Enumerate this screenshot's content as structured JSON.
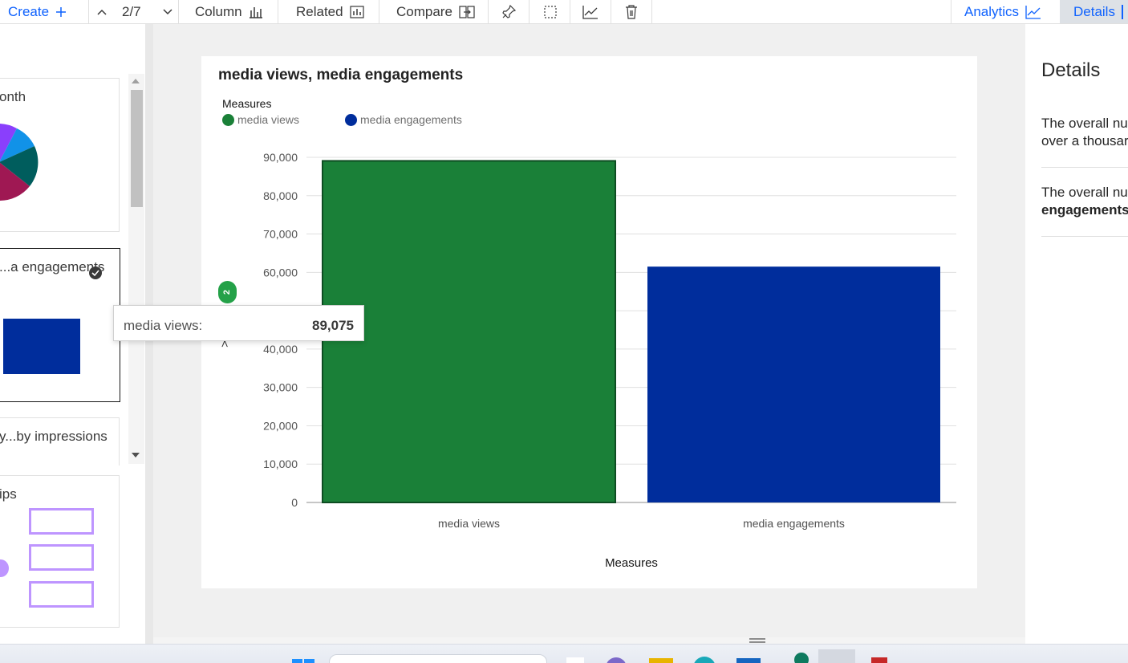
{
  "toolbar": {
    "create_label": "Create",
    "pager": "2/7",
    "column_label": "Column",
    "related_label": "Related",
    "compare_label": "Compare",
    "analytics_label": "Analytics",
    "details_label": "Details"
  },
  "left_panel": {
    "cards": [
      {
        "title": "onth"
      },
      {
        "title": "...a engagements"
      },
      {
        "title": "y...by impressions"
      },
      {
        "title": "ips"
      }
    ]
  },
  "chart": {
    "tooltip_label": "media views:",
    "tooltip_value": "89,075",
    "badge": "2",
    "yaxis_partial": ">"
  },
  "chart_data": {
    "type": "bar",
    "title": "media views, media engagements",
    "legend_title": "Measures",
    "categories": [
      "media views",
      "media engagements"
    ],
    "series": [
      {
        "name": "media views",
        "values": [
          89075,
          null
        ],
        "color": "#1a8038"
      },
      {
        "name": "media engagements",
        "values": [
          null,
          61500
        ],
        "color": "#002d9c"
      }
    ],
    "xlabel": "Measures",
    "ylabel": "",
    "ylim": [
      0,
      90000
    ],
    "yticks": [
      "0",
      "10,000",
      "20,000",
      "30,000",
      "40,000",
      "50,000",
      "60,000",
      "70,000",
      "80,000",
      "90,000"
    ],
    "grid": true,
    "legend_position": "top-left"
  },
  "right_panel": {
    "title": "Details",
    "line1a": "The overall nu",
    "line1b": "over a thousar",
    "line2a": "The overall nu",
    "line2b": "engagements"
  },
  "colors": {
    "green": "#1a8038",
    "blue": "#002d9c",
    "accent": "#0f62fe"
  }
}
